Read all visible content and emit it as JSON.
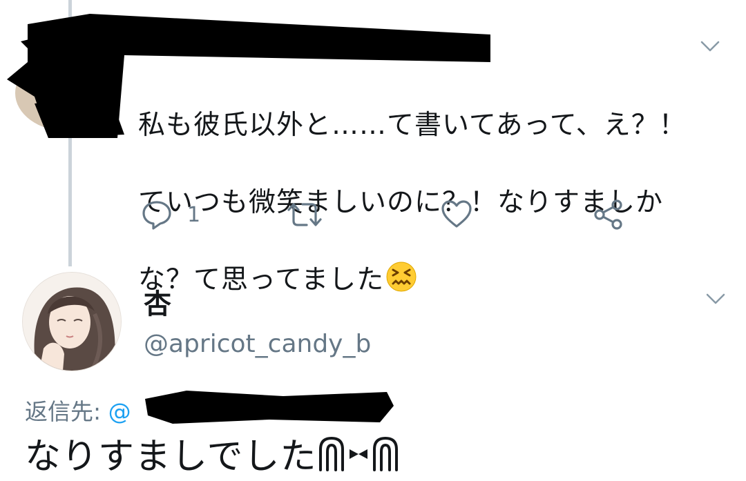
{
  "tweet1": {
    "lines": [
      "私も彼氏以外と……て書いてあって、え？！",
      "ていつも微笑ましいのに？！なりすましか",
      "な？て思ってました"
    ],
    "emoji": "confounded-face",
    "reply_count": "1",
    "icons": [
      "reply-icon",
      "retweet-icon",
      "like-icon",
      "share-icon"
    ]
  },
  "tweet2": {
    "display_name": "杏",
    "handle": "@apricot_candy_b",
    "reply_to_label": "返信先:",
    "reply_to_at": "@",
    "text": "なりすましでした",
    "kaomoji": "ᕱ⑅ᕱ"
  },
  "colors": {
    "thread_line": "#cbd3da",
    "secondary_text": "#657786",
    "link": "#1da1f2",
    "primary_text": "#14171a"
  }
}
